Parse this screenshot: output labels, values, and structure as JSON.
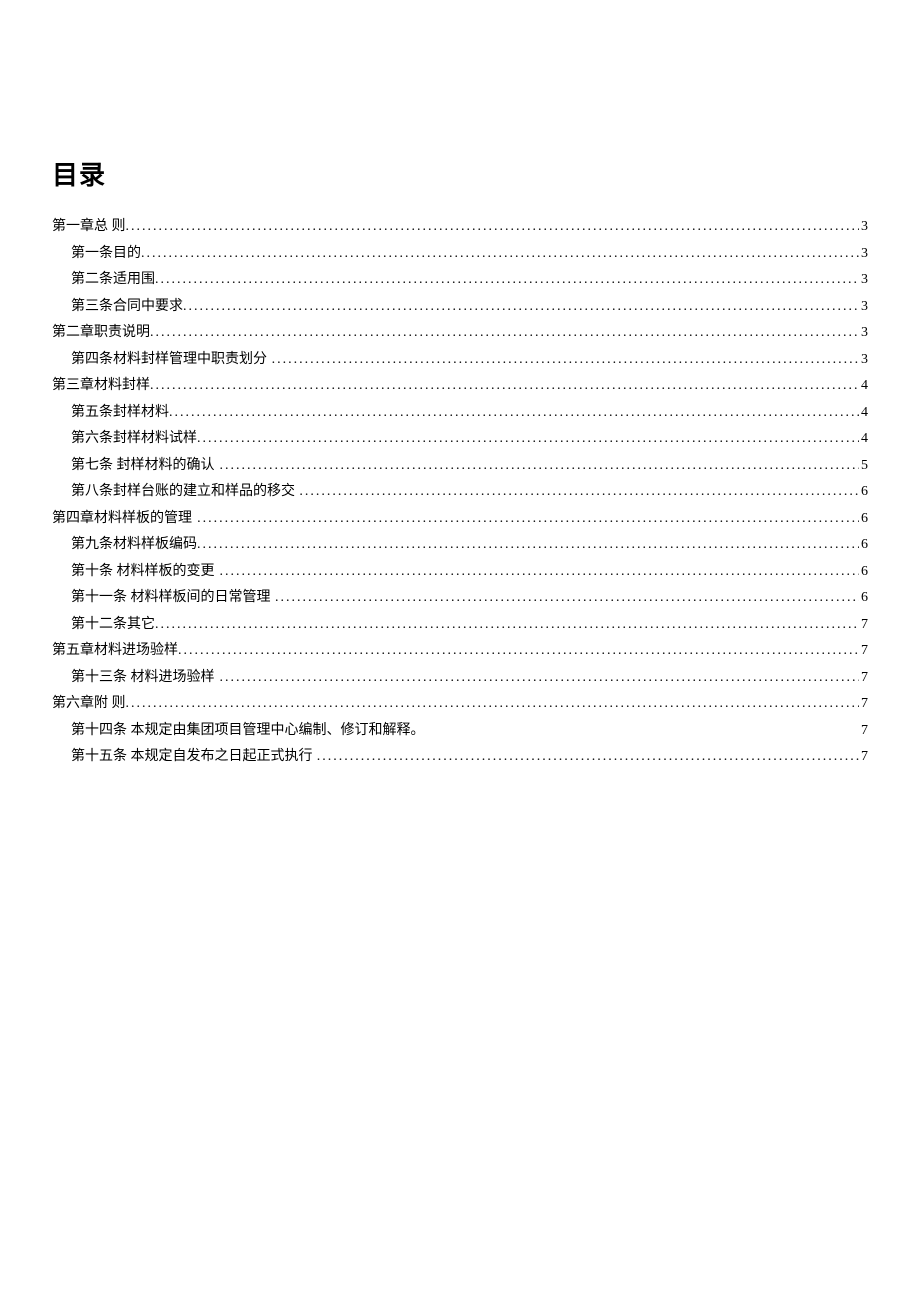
{
  "title": "目录",
  "toc": [
    {
      "level": 0,
      "label": "第一章总 则",
      "page": "3",
      "dots": true
    },
    {
      "level": 1,
      "label": "第一条目的",
      "page": "3",
      "dots": true
    },
    {
      "level": 1,
      "label": "第二条适用围",
      "page": "3",
      "dots": true
    },
    {
      "level": 1,
      "label": "第三条合同中要求",
      "page": "3",
      "dots": true
    },
    {
      "level": 0,
      "label": "第二章职责说明",
      "page": "3",
      "dots": true
    },
    {
      "level": 1,
      "label": "第四条材料封样管理中职责划分",
      "page": "3",
      "dots": true,
      "gap": true
    },
    {
      "level": 0,
      "label": "第三章材料封样",
      "page": "4",
      "dots": true
    },
    {
      "level": 1,
      "label": "第五条封样材料",
      "page": "4",
      "dots": true
    },
    {
      "level": 1,
      "label": "第六条封样材料试样",
      "page": "4",
      "dots": true
    },
    {
      "level": 1,
      "label": "第七条 封样材料的确认",
      "page": " 5",
      "dots": true,
      "gap": true
    },
    {
      "level": 1,
      "label": "第八条封样台账的建立和样品的移交",
      "page": "6",
      "dots": true,
      "gap": true
    },
    {
      "level": 0,
      "label": "第四章材料样板的管理",
      "page": "6",
      "dots": true,
      "gap": true
    },
    {
      "level": 1,
      "label": "第九条材料样板编码",
      "page": "6",
      "dots": true
    },
    {
      "level": 1,
      "label": "第十条 材料样板的变更",
      "page": " 6",
      "dots": true,
      "gap": true
    },
    {
      "level": 1,
      "label": "第十一条 材料样板间的日常管理",
      "page": " 6",
      "dots": true,
      "gap": true
    },
    {
      "level": 1,
      "label": "第十二条其它",
      "page": "7",
      "dots": true
    },
    {
      "level": 0,
      "label": "第五章材料进场验样",
      "page": "7",
      "dots": true
    },
    {
      "level": 1,
      "label": "第十三条 材料进场验样",
      "page": "7",
      "dots": true,
      "gap": true
    },
    {
      "level": 0,
      "label": "第六章附 则",
      "page": "7",
      "dots": true
    },
    {
      "level": 1,
      "label": "第十四条 本规定由集团项目管理中心编制、修订和解释。",
      "page": "7",
      "dots": false
    },
    {
      "level": 1,
      "label": "第十五条 本规定自发布之日起正式执行",
      "page": " 7",
      "dots": true,
      "gap": true
    }
  ]
}
